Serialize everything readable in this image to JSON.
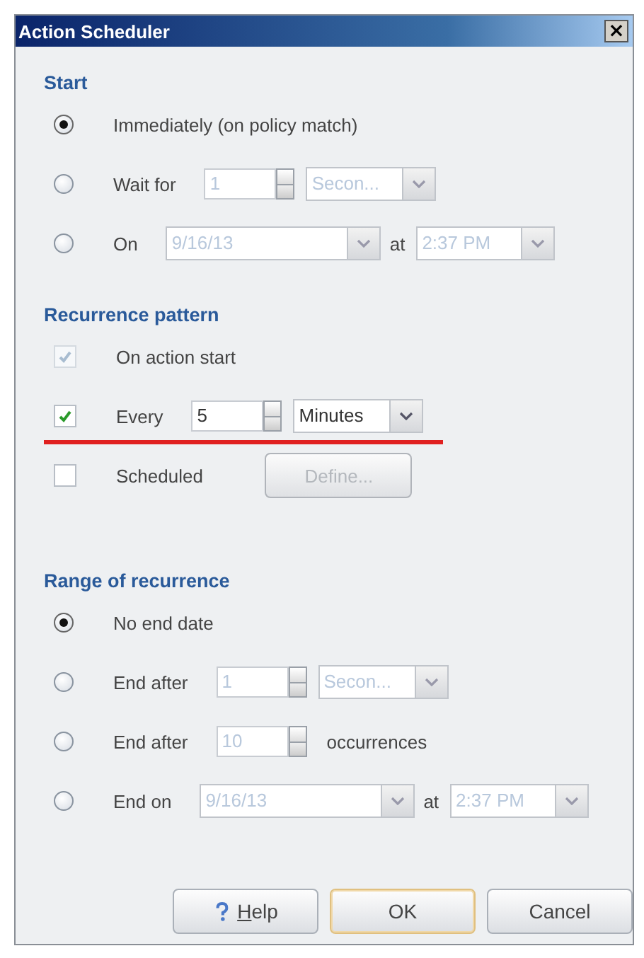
{
  "window": {
    "title": "Action Scheduler",
    "close": "×"
  },
  "sections": [
    {
      "title": "Start",
      "rows": [
        {
          "kind": "radio",
          "label": "Immediately (on policy match)",
          "selected": true,
          "highlighted": false,
          "controls": []
        },
        {
          "kind": "radio",
          "label": "Wait for",
          "selected": false,
          "highlighted": false,
          "controls": [
            {
              "kind": "spinner",
              "value": "1",
              "disabled": true
            },
            {
              "kind": "unit-combo",
              "value": "Secon...",
              "disabled": true
            }
          ]
        },
        {
          "kind": "radio",
          "label": "On",
          "selected": false,
          "highlighted": false,
          "controls": [
            {
              "kind": "date-combo",
              "value": "9/16/13",
              "disabled": true
            },
            {
              "kind": "text",
              "value": "at"
            },
            {
              "kind": "time-combo",
              "value": "2:37 PM",
              "disabled": true
            }
          ]
        }
      ]
    },
    {
      "title": "Recurrence pattern",
      "rows": [
        {
          "kind": "checkbox",
          "label": "On action start",
          "checked": true,
          "disabled": true,
          "highlighted": false,
          "controls": []
        },
        {
          "kind": "checkbox",
          "label": "Every",
          "checked": true,
          "disabled": false,
          "highlighted": true,
          "controls": [
            {
              "kind": "spinner",
              "value": "5",
              "disabled": false
            },
            {
              "kind": "unit-combo",
              "value": "Minutes",
              "disabled": false
            }
          ]
        },
        {
          "kind": "checkbox",
          "label": "Scheduled",
          "checked": false,
          "disabled": false,
          "highlighted": false,
          "controls": [
            {
              "kind": "button",
              "value": "Define...",
              "disabled": true
            }
          ]
        }
      ]
    },
    {
      "title": "Range of recurrence",
      "rows": [
        {
          "kind": "radio",
          "label": "No end date",
          "selected": true,
          "highlighted": false,
          "controls": []
        },
        {
          "kind": "radio",
          "label": "End after",
          "selected": false,
          "highlighted": false,
          "controls": [
            {
              "kind": "spinner",
              "value": "1",
              "disabled": true
            },
            {
              "kind": "unit-combo",
              "value": "Secon...",
              "disabled": true
            }
          ]
        },
        {
          "kind": "radio",
          "label": "End after",
          "selected": false,
          "highlighted": false,
          "controls": [
            {
              "kind": "spinner",
              "value": "10",
              "disabled": true
            },
            {
              "kind": "text",
              "value": "occurrences"
            }
          ]
        },
        {
          "kind": "radio",
          "label": "End on",
          "selected": false,
          "highlighted": false,
          "controls": [
            {
              "kind": "date-combo",
              "value": "9/16/13",
              "disabled": true
            },
            {
              "kind": "text",
              "value": "at"
            },
            {
              "kind": "time-combo",
              "value": "2:37 PM",
              "disabled": true
            }
          ]
        }
      ]
    }
  ],
  "buttons": [
    {
      "kind": "help",
      "label": "Help",
      "mnemonic_first": true,
      "default": false
    },
    {
      "kind": "plain",
      "label": "OK",
      "mnemonic_first": false,
      "default": true
    },
    {
      "kind": "plain",
      "label": "Cancel",
      "mnemonic_first": false,
      "default": false
    }
  ]
}
